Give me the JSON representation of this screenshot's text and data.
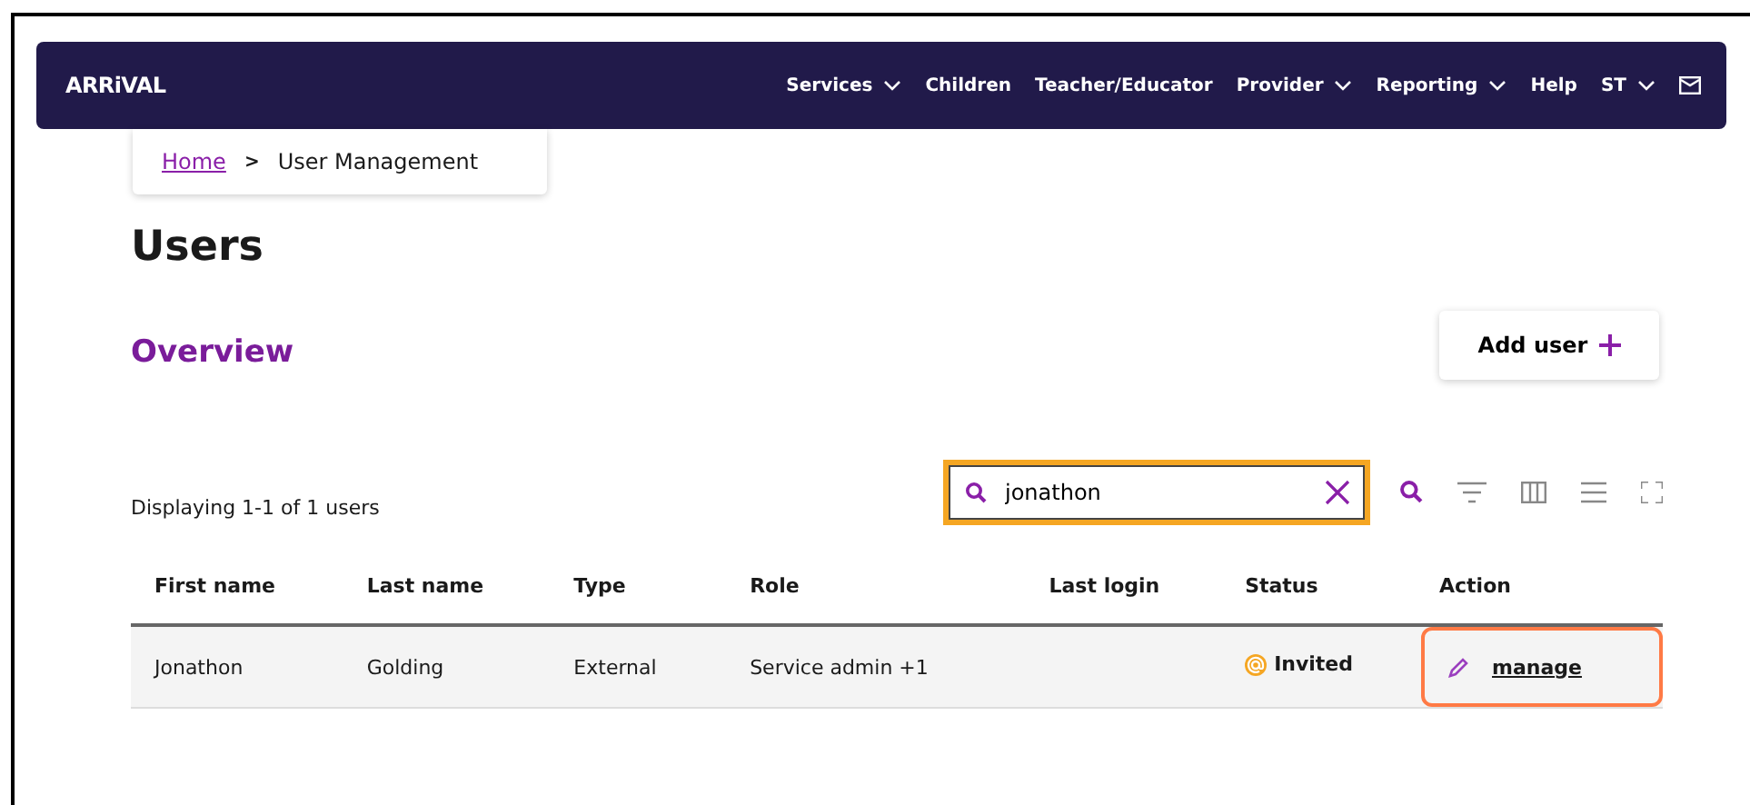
{
  "brand": "ARRiVAL",
  "nav": [
    {
      "label": "Services",
      "has_menu": true
    },
    {
      "label": "Children",
      "has_menu": false
    },
    {
      "label": "Teacher/Educator",
      "has_menu": false
    },
    {
      "label": "Provider",
      "has_menu": true
    },
    {
      "label": "Reporting",
      "has_menu": true
    },
    {
      "label": "Help",
      "has_menu": false
    },
    {
      "label": "ST",
      "has_menu": true
    }
  ],
  "breadcrumb": [
    {
      "label": "Home",
      "link": true
    },
    {
      "label": "User Management",
      "link": false
    }
  ],
  "breadcrumb_separator": ">",
  "title": "Users",
  "section_title": "Overview",
  "add_button": "Add user",
  "count_text": "Displaying 1-1 of 1 users",
  "search": {
    "value": "jonathon",
    "focused": true
  },
  "table": {
    "columns": [
      "First name",
      "Last name",
      "Type",
      "Role",
      "Last login",
      "Status",
      "Action"
    ],
    "rows": [
      {
        "cells": [
          "Jonathon",
          "Golding",
          "External",
          "Service admin +1",
          ""
        ],
        "status": "Invited",
        "action": "manage",
        "action_focused": true
      }
    ]
  }
}
